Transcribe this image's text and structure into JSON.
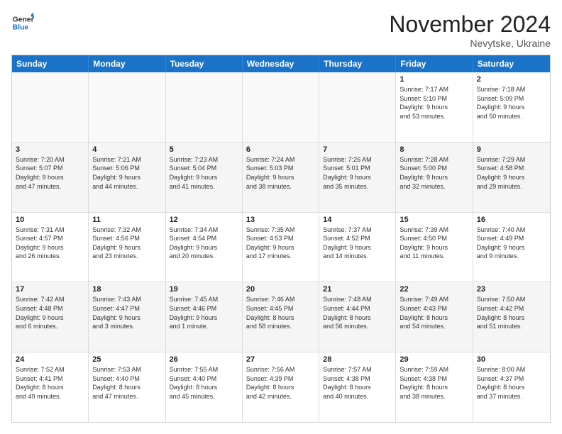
{
  "logo": {
    "line1": "General",
    "line2": "Blue"
  },
  "title": "November 2024",
  "location": "Nevytske, Ukraine",
  "header_days": [
    "Sunday",
    "Monday",
    "Tuesday",
    "Wednesday",
    "Thursday",
    "Friday",
    "Saturday"
  ],
  "rows": [
    [
      {
        "day": "",
        "info": ""
      },
      {
        "day": "",
        "info": ""
      },
      {
        "day": "",
        "info": ""
      },
      {
        "day": "",
        "info": ""
      },
      {
        "day": "",
        "info": ""
      },
      {
        "day": "1",
        "info": "Sunrise: 7:17 AM\nSunset: 5:10 PM\nDaylight: 9 hours\nand 53 minutes."
      },
      {
        "day": "2",
        "info": "Sunrise: 7:18 AM\nSunset: 5:09 PM\nDaylight: 9 hours\nand 50 minutes."
      }
    ],
    [
      {
        "day": "3",
        "info": "Sunrise: 7:20 AM\nSunset: 5:07 PM\nDaylight: 9 hours\nand 47 minutes."
      },
      {
        "day": "4",
        "info": "Sunrise: 7:21 AM\nSunset: 5:06 PM\nDaylight: 9 hours\nand 44 minutes."
      },
      {
        "day": "5",
        "info": "Sunrise: 7:23 AM\nSunset: 5:04 PM\nDaylight: 9 hours\nand 41 minutes."
      },
      {
        "day": "6",
        "info": "Sunrise: 7:24 AM\nSunset: 5:03 PM\nDaylight: 9 hours\nand 38 minutes."
      },
      {
        "day": "7",
        "info": "Sunrise: 7:26 AM\nSunset: 5:01 PM\nDaylight: 9 hours\nand 35 minutes."
      },
      {
        "day": "8",
        "info": "Sunrise: 7:28 AM\nSunset: 5:00 PM\nDaylight: 9 hours\nand 32 minutes."
      },
      {
        "day": "9",
        "info": "Sunrise: 7:29 AM\nSunset: 4:58 PM\nDaylight: 9 hours\nand 29 minutes."
      }
    ],
    [
      {
        "day": "10",
        "info": "Sunrise: 7:31 AM\nSunset: 4:57 PM\nDaylight: 9 hours\nand 26 minutes."
      },
      {
        "day": "11",
        "info": "Sunrise: 7:32 AM\nSunset: 4:56 PM\nDaylight: 9 hours\nand 23 minutes."
      },
      {
        "day": "12",
        "info": "Sunrise: 7:34 AM\nSunset: 4:54 PM\nDaylight: 9 hours\nand 20 minutes."
      },
      {
        "day": "13",
        "info": "Sunrise: 7:35 AM\nSunset: 4:53 PM\nDaylight: 9 hours\nand 17 minutes."
      },
      {
        "day": "14",
        "info": "Sunrise: 7:37 AM\nSunset: 4:52 PM\nDaylight: 9 hours\nand 14 minutes."
      },
      {
        "day": "15",
        "info": "Sunrise: 7:39 AM\nSunset: 4:50 PM\nDaylight: 9 hours\nand 11 minutes."
      },
      {
        "day": "16",
        "info": "Sunrise: 7:40 AM\nSunset: 4:49 PM\nDaylight: 9 hours\nand 9 minutes."
      }
    ],
    [
      {
        "day": "17",
        "info": "Sunrise: 7:42 AM\nSunset: 4:48 PM\nDaylight: 9 hours\nand 6 minutes."
      },
      {
        "day": "18",
        "info": "Sunrise: 7:43 AM\nSunset: 4:47 PM\nDaylight: 9 hours\nand 3 minutes."
      },
      {
        "day": "19",
        "info": "Sunrise: 7:45 AM\nSunset: 4:46 PM\nDaylight: 9 hours\nand 1 minute."
      },
      {
        "day": "20",
        "info": "Sunrise: 7:46 AM\nSunset: 4:45 PM\nDaylight: 8 hours\nand 58 minutes."
      },
      {
        "day": "21",
        "info": "Sunrise: 7:48 AM\nSunset: 4:44 PM\nDaylight: 8 hours\nand 56 minutes."
      },
      {
        "day": "22",
        "info": "Sunrise: 7:49 AM\nSunset: 4:43 PM\nDaylight: 8 hours\nand 54 minutes."
      },
      {
        "day": "23",
        "info": "Sunrise: 7:50 AM\nSunset: 4:42 PM\nDaylight: 8 hours\nand 51 minutes."
      }
    ],
    [
      {
        "day": "24",
        "info": "Sunrise: 7:52 AM\nSunset: 4:41 PM\nDaylight: 8 hours\nand 49 minutes."
      },
      {
        "day": "25",
        "info": "Sunrise: 7:53 AM\nSunset: 4:40 PM\nDaylight: 8 hours\nand 47 minutes."
      },
      {
        "day": "26",
        "info": "Sunrise: 7:55 AM\nSunset: 4:40 PM\nDaylight: 8 hours\nand 45 minutes."
      },
      {
        "day": "27",
        "info": "Sunrise: 7:56 AM\nSunset: 4:39 PM\nDaylight: 8 hours\nand 42 minutes."
      },
      {
        "day": "28",
        "info": "Sunrise: 7:57 AM\nSunset: 4:38 PM\nDaylight: 8 hours\nand 40 minutes."
      },
      {
        "day": "29",
        "info": "Sunrise: 7:59 AM\nSunset: 4:38 PM\nDaylight: 8 hours\nand 38 minutes."
      },
      {
        "day": "30",
        "info": "Sunrise: 8:00 AM\nSunset: 4:37 PM\nDaylight: 8 hours\nand 37 minutes."
      }
    ]
  ]
}
